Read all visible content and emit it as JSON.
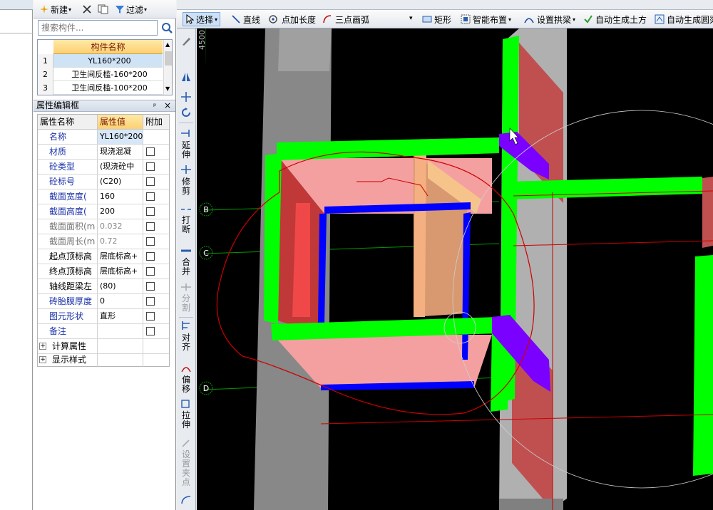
{
  "toolbar_left": {
    "new_label": "新建",
    "filter_label": "过滤"
  },
  "search": {
    "placeholder": "搜索构件..."
  },
  "component_list": {
    "header": "构件名称",
    "rows": [
      {
        "no": "1",
        "name": "YL160*200"
      },
      {
        "no": "2",
        "name": "卫生间反槛-160*200"
      },
      {
        "no": "3",
        "name": "卫生间反槛-100*200"
      }
    ]
  },
  "property_panel": {
    "title": "属性编辑框",
    "pin": "ᵖ",
    "close": "×",
    "col_name": "属性名称",
    "col_value": "属性值",
    "col_extra": "附加",
    "rows": [
      {
        "name": "名称",
        "value": "YL160*200"
      },
      {
        "name": "材质",
        "value": "现浇混凝"
      },
      {
        "name": "砼类型",
        "value": "(现浇砼中"
      },
      {
        "name": "砼标号",
        "value": "(C20)"
      },
      {
        "name": "截面宽度(",
        "value": "160"
      },
      {
        "name": "截面高度(",
        "value": "200"
      },
      {
        "name": "截面面积(m",
        "value": "0.032"
      },
      {
        "name": "截面周长(m",
        "value": "0.72"
      },
      {
        "name": "起点顶标高",
        "value": "层底标高+"
      },
      {
        "name": "终点顶标高",
        "value": "层底标高+"
      },
      {
        "name": "轴线距梁左",
        "value": "(80)"
      },
      {
        "name": "砖胎膜厚度",
        "value": "0"
      },
      {
        "name": "图元形状",
        "value": "直形"
      },
      {
        "name": "备注",
        "value": ""
      }
    ],
    "groups": [
      "计算属性",
      "显示样式"
    ]
  },
  "main_toolbar": {
    "select": "选择",
    "line": "直线",
    "point_length": "点加长度",
    "arc": "三点画弧",
    "rect": "矩形",
    "smart_layout": "智能布置",
    "set_arch_beam": "设置拱梁",
    "auto_earthwork": "自动生成土方",
    "auto_round": "自动生成圆梁"
  },
  "vertical_tools": {
    "extend": "延伸",
    "trim": "修剪",
    "break": "打断",
    "merge": "合并",
    "split": "分割",
    "align": "对齐",
    "offset": "偏移",
    "stretch": "拉伸",
    "set_grip": "设置夹点"
  },
  "canvas": {
    "axis_labels": [
      "B",
      "C",
      "D"
    ],
    "dimension": "4500"
  },
  "colors": {
    "canvas_bg": "#000000",
    "beam_green": "#00ff00",
    "slab_pink": "#f4a0a0",
    "edge_blue": "#0000ff",
    "grip_purple": "#7a00ff",
    "markup_red": "#cc0000"
  }
}
